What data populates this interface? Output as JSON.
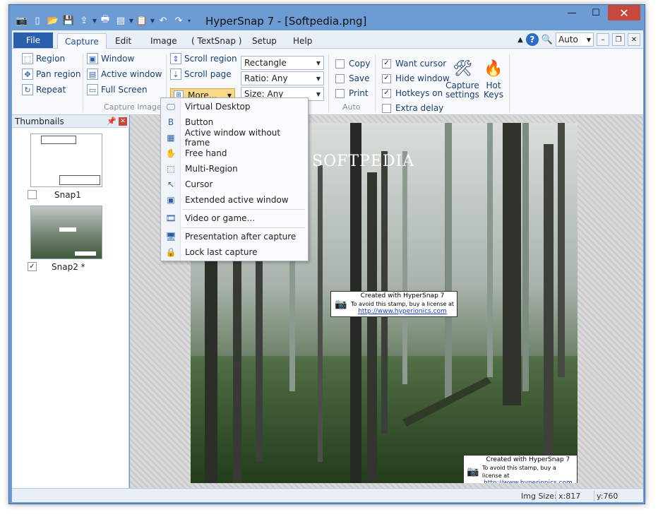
{
  "window": {
    "title": "HyperSnap 7 - [Softpedia.png]",
    "controls": {
      "minimize": "—",
      "maximize": "☐",
      "close": "✕"
    }
  },
  "qat": {
    "icons": [
      "app-icon",
      "new-icon",
      "open-icon",
      "save-icon",
      "upload-icon",
      "print-icon",
      "scan-icon",
      "paste-icon",
      "undo-icon",
      "redo-icon"
    ]
  },
  "tabs": {
    "file": "File",
    "items": [
      "Capture",
      "Edit",
      "Image",
      "( TextSnap )",
      "Setup",
      "Help"
    ],
    "active": "Capture"
  },
  "toolbar_right": {
    "zoom_value": "Auto",
    "help": "?"
  },
  "ribbon": {
    "capture_group": {
      "label": "Capture Image",
      "col1": [
        "Region",
        "Pan region",
        "Repeat"
      ],
      "col2": [
        "Window",
        "Active window",
        "Full Screen"
      ],
      "col3": [
        "Scroll region",
        "Scroll page"
      ],
      "more": "More..."
    },
    "combos": {
      "shape": "Rectangle",
      "ratio": "Ratio: Any",
      "size": "Size: Any"
    },
    "auto_group": {
      "label": "Auto",
      "items": [
        {
          "label": "Copy",
          "checked": false
        },
        {
          "label": "Save",
          "checked": false
        },
        {
          "label": "Print",
          "checked": false
        }
      ]
    },
    "options": [
      {
        "label": "Want cursor",
        "checked": true
      },
      {
        "label": "Hide window",
        "checked": true
      },
      {
        "label": "Hotkeys on",
        "checked": true
      },
      {
        "label": "Extra delay",
        "checked": false
      }
    ],
    "capture_settings": {
      "line1": "Capture",
      "line2": "settings"
    },
    "hot_keys": {
      "line1": "Hot",
      "line2": "Keys"
    }
  },
  "thumbnails": {
    "header": "Thumbnails",
    "items": [
      {
        "label": "Snap1",
        "checked": false
      },
      {
        "label": "Snap2 *",
        "checked": true
      }
    ]
  },
  "menu": {
    "items": [
      "Virtual Desktop",
      "Button",
      "Active window without frame",
      "Free hand",
      "Multi-Region",
      "Cursor",
      "Extended active window",
      "Video or game...",
      "Presentation after capture",
      "Lock last capture"
    ]
  },
  "image": {
    "watermark": "SOFTPEDIA",
    "stamp_line1": "Created with HyperSnap 7",
    "stamp_line2": "To avoid this stamp, buy a license at",
    "stamp_link": "http://www.hyperionics.com"
  },
  "status": {
    "img_size_label": "Img Size:",
    "x": "x:817",
    "y": "y:760"
  },
  "colors": {
    "title_bar": "#6d9bd4",
    "file_tab": "#2a5fae",
    "highlight": "#f8d98a",
    "close_btn": "#c7483d"
  }
}
